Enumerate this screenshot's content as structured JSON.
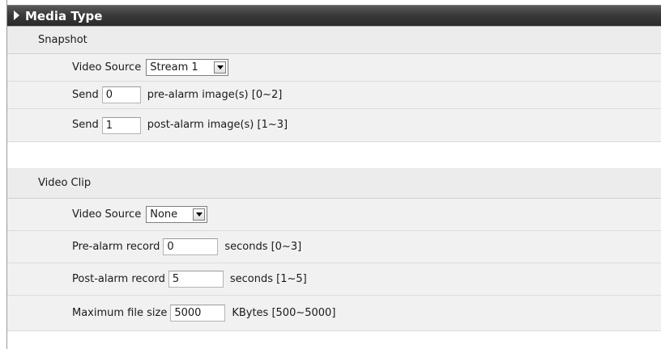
{
  "header": {
    "title": "Media Type"
  },
  "snapshot": {
    "section_label": "Snapshot",
    "video_source": {
      "label": "Video Source",
      "selected": "Stream 1"
    },
    "pre_alarm": {
      "prefix": "Send",
      "value": "0",
      "suffix": "pre-alarm image(s) [0~2]"
    },
    "post_alarm": {
      "prefix": "Send",
      "value": "1",
      "suffix": "post-alarm image(s) [1~3]"
    }
  },
  "video_clip": {
    "section_label": "Video Clip",
    "video_source": {
      "label": "Video Source",
      "selected": "None"
    },
    "pre_alarm_record": {
      "label": "Pre-alarm record",
      "value": "0",
      "suffix": "seconds [0~3]"
    },
    "post_alarm_record": {
      "label": "Post-alarm record",
      "value": "5",
      "suffix": "seconds [1~5]"
    },
    "max_file_size": {
      "label": "Maximum file size",
      "value": "5000",
      "suffix": "KBytes [500~5000]"
    }
  }
}
